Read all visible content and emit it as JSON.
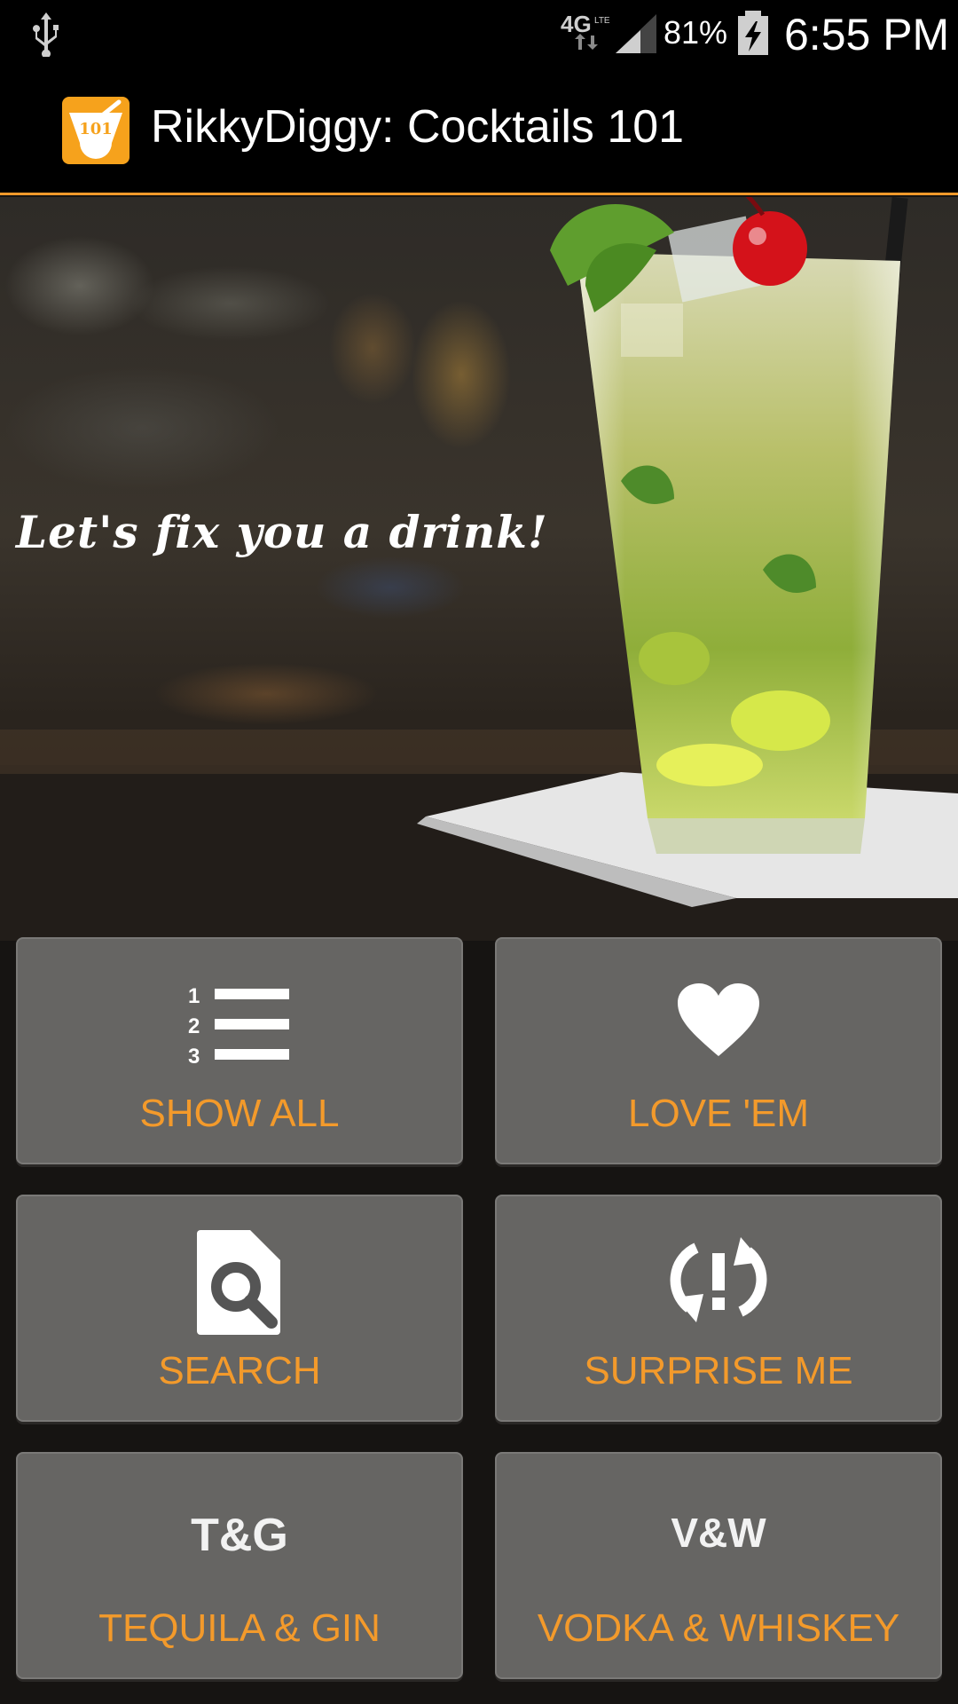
{
  "status_bar": {
    "network": "4G LTE",
    "battery_percent": "81%",
    "time": "6:55 PM",
    "icons": [
      "usb-icon",
      "network-icon",
      "signal-icon",
      "battery-charging-icon"
    ]
  },
  "action_bar": {
    "app_icon_text": "101",
    "title": "RikkyDiggy: Cocktails 101"
  },
  "hero": {
    "tagline": "Let's fix you a drink!"
  },
  "menu": [
    {
      "label": "SHOW ALL",
      "icon": "numbered-list-icon"
    },
    {
      "label": "LOVE 'EM",
      "icon": "heart-icon"
    },
    {
      "label": "SEARCH",
      "icon": "file-search-icon"
    },
    {
      "label": "SURPRISE ME",
      "icon": "refresh-exclamation-icon"
    },
    {
      "label": "TEQUILA & GIN",
      "code": "T&G"
    },
    {
      "label": "VODKA & WHISKEY",
      "code": "V&W"
    }
  ],
  "colors": {
    "accent": "#f39a2b",
    "tile": "#666563",
    "bar": "#000000"
  }
}
